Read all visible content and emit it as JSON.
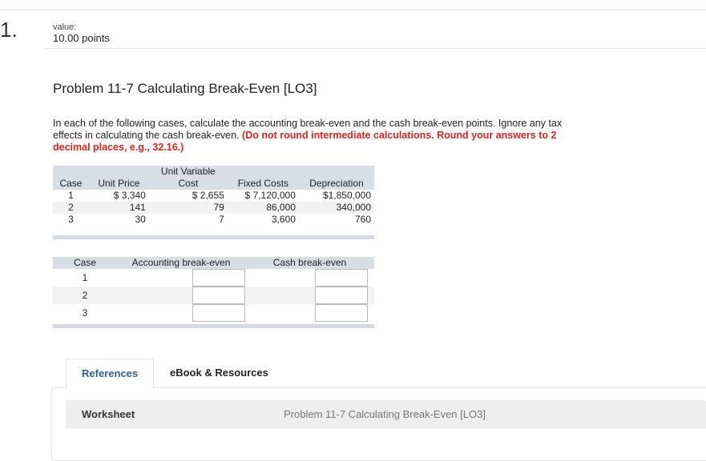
{
  "question": {
    "number": "1.",
    "value_label": "value:",
    "value": "10.00 points"
  },
  "problem": {
    "title": "Problem 11-7 Calculating Break-Even [LO3]",
    "instructions": "In each of the following cases, calculate the accounting break-even and the cash break-even points. Ignore any tax effects in calculating the cash break-even.",
    "emphasis": "(Do not round intermediate calculations. Round your answers to 2 decimal places, e.g., 32.16.)"
  },
  "given_table": {
    "headers": [
      "Case",
      "Unit Price",
      "Unit Variable Cost",
      "Fixed Costs",
      "Depreciation"
    ],
    "rows": [
      [
        "1",
        "$ 3,340",
        "$ 2,655",
        "$  7,120,000",
        "$1,850,000"
      ],
      [
        "2",
        "141",
        "79",
        "86,000",
        "340,000"
      ],
      [
        "3",
        "30",
        "7",
        "3,600",
        "760"
      ]
    ]
  },
  "answer_table": {
    "headers": [
      "Case",
      "Accounting break-even",
      "Cash break-even"
    ],
    "rows": [
      {
        "case": "1",
        "accounting": "",
        "cash": ""
      },
      {
        "case": "2",
        "accounting": "",
        "cash": ""
      },
      {
        "case": "3",
        "accounting": "",
        "cash": ""
      }
    ]
  },
  "tabs": [
    {
      "label": "References"
    },
    {
      "label": "eBook & Resources"
    }
  ],
  "worksheet": {
    "label": "Worksheet",
    "link": "Problem 11-7 Calculating Break-Even [LO3]"
  }
}
